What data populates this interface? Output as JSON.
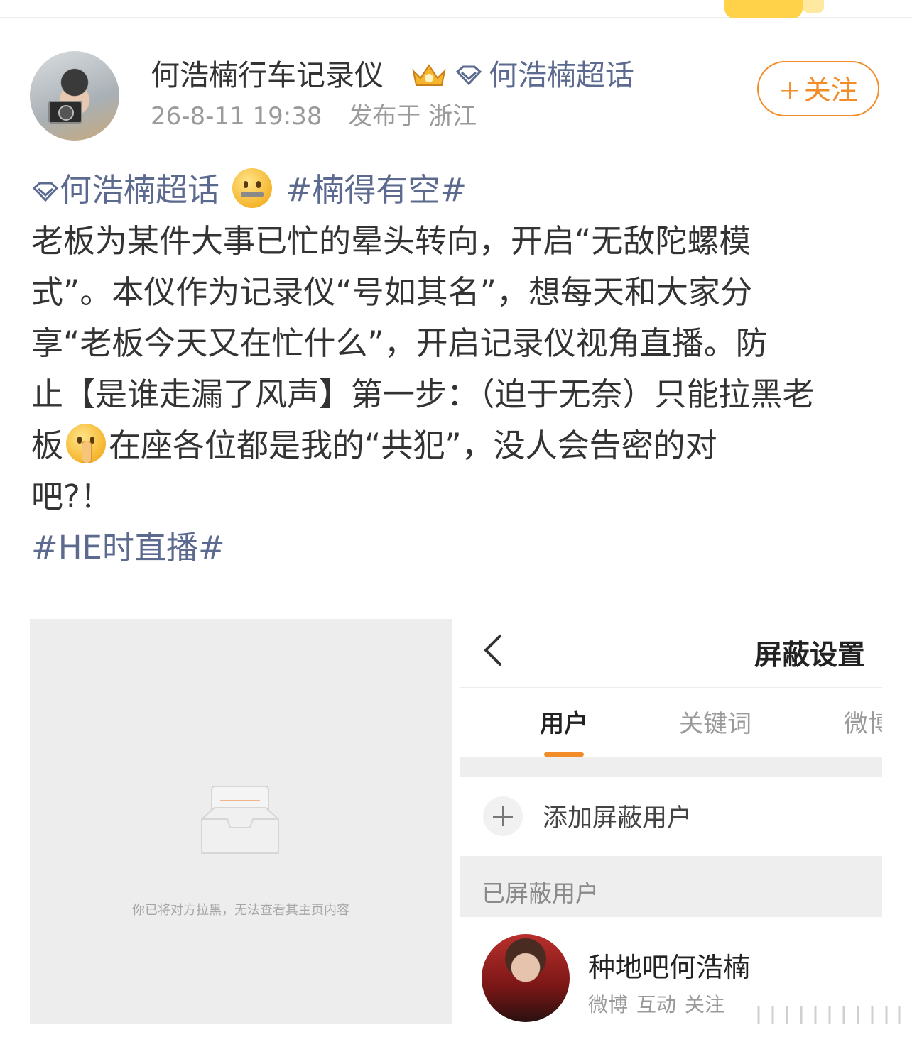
{
  "post": {
    "username": "何浩楠行车记录仪",
    "supertopic_tag": "何浩楠超话",
    "timestamp": "26-8-11 19:38",
    "location": "发布于 浙江",
    "follow_label": "关注",
    "follow_plus": "+",
    "body_lines": [
      {
        "parts": [
          {
            "text": "何浩楠超话",
            "type": "supertopic"
          },
          {
            "type": "emoji",
            "name": "zipper-mouth-emoji"
          },
          {
            "text": "#楠得有空#",
            "type": "hashtag"
          }
        ]
      },
      {
        "parts": [
          {
            "text": "老板为某件大事已忙的晕头转向，开启“无敌陀螺模",
            "type": "text"
          }
        ]
      },
      {
        "parts": [
          {
            "text": "式”。本仪作为记录仪“号如其名”，想每天和大家分",
            "type": "text"
          }
        ]
      },
      {
        "parts": [
          {
            "text": "享“老板今天又在忙什么”，开启记录仪视角直播。防",
            "type": "text"
          }
        ]
      },
      {
        "parts": [
          {
            "text": "止【是谁走漏了风声】第一步：（迫于无奈）只能拉黑老",
            "type": "text"
          }
        ]
      },
      {
        "parts": [
          {
            "text": "板",
            "type": "text"
          },
          {
            "type": "emoji",
            "name": "shushing-face-emoji"
          },
          {
            "text": "在座各位都是我的“共犯”，没人会告密的对",
            "type": "text"
          }
        ]
      },
      {
        "parts": [
          {
            "text": "吧?！",
            "type": "text"
          }
        ]
      },
      {
        "parts": [
          {
            "text": "#HE时直播#",
            "type": "hashtag"
          }
        ]
      }
    ]
  },
  "left_image": {
    "message": "你已将对方拉黑，无法查看其主页内容"
  },
  "right_image": {
    "title": "屏蔽设置",
    "tabs": [
      {
        "label": "用户",
        "active": true
      },
      {
        "label": "关键词",
        "active": false
      },
      {
        "label": "微博",
        "active": false
      }
    ],
    "add_label": "添加屏蔽用户",
    "section_label": "已屏蔽用户",
    "blocked_user": {
      "name": "种地吧何浩楠",
      "tags": [
        "微博",
        "互动",
        "关注"
      ]
    }
  },
  "colors": {
    "accent_orange": "#f28c28",
    "link_blue": "#5b6a8e",
    "text_main": "#333333",
    "text_muted": "#9a9a9a"
  }
}
